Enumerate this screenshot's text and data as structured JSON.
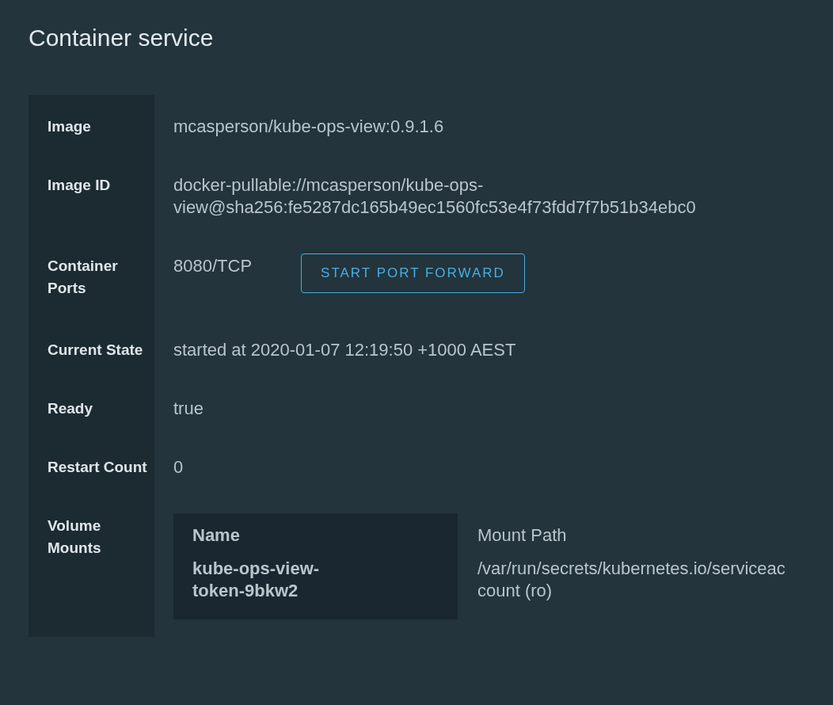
{
  "title": "Container service",
  "rows": [
    {
      "kind": "text",
      "label": "Image",
      "value": "mcasperson/kube-ops-view:0.9.1.6"
    },
    {
      "kind": "text",
      "label": "Image ID",
      "value": "docker-pullable://mcasperson/kube-ops-view@sha256:fe5287dc165b49ec1560fc53e4f73fdd7f7b51b34ebc0"
    },
    {
      "kind": "ports",
      "label": "Container Ports",
      "value": "8080/TCP",
      "button": "START PORT FORWARD"
    },
    {
      "kind": "text",
      "label": "Current State",
      "value": "started at 2020-01-07 12:19:50 +1000 AEST"
    },
    {
      "kind": "text",
      "label": "Ready",
      "value": "true"
    },
    {
      "kind": "text",
      "label": "Restart Count",
      "value": "0"
    },
    {
      "kind": "table",
      "label": "Volume Mounts",
      "columns": [
        "Name",
        "Mount Path"
      ],
      "rows": [
        [
          "kube-ops-view-token-9bkw2",
          "/var/run/secrets/kubernetes.io/serviceaccount (ro)"
        ]
      ]
    }
  ]
}
